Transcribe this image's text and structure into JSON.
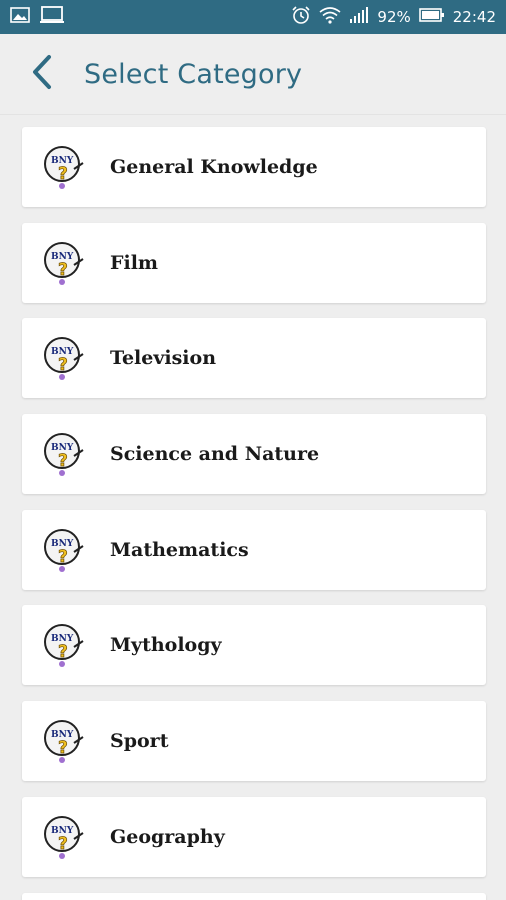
{
  "status_bar": {
    "battery_text": "92%",
    "time": "22:42",
    "icons": [
      "image-icon",
      "screen-cast-icon",
      "alarm-icon",
      "wifi-icon",
      "signal-icon",
      "battery-icon"
    ]
  },
  "app_bar": {
    "title": "Select Category",
    "back_icon": "back-arrow-icon"
  },
  "categories": [
    {
      "label": "General Knowledge",
      "icon": "quiz-logo-icon"
    },
    {
      "label": "Film",
      "icon": "quiz-logo-icon"
    },
    {
      "label": "Television",
      "icon": "quiz-logo-icon"
    },
    {
      "label": "Science and Nature",
      "icon": "quiz-logo-icon"
    },
    {
      "label": "Mathematics",
      "icon": "quiz-logo-icon"
    },
    {
      "label": "Mythology",
      "icon": "quiz-logo-icon"
    },
    {
      "label": "Sport",
      "icon": "quiz-logo-icon"
    },
    {
      "label": "Geography",
      "icon": "quiz-logo-icon"
    }
  ],
  "colors": {
    "status_bar": "#2f6b83",
    "accent": "#2f6b83",
    "background": "#eeeeee"
  }
}
